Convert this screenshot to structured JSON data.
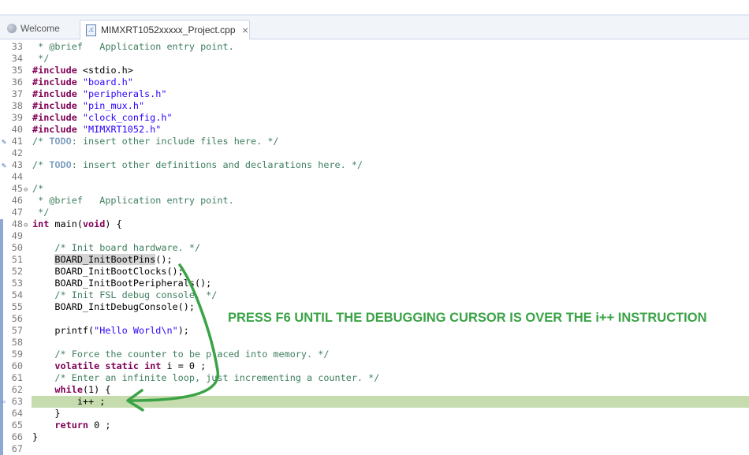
{
  "tabs": [
    {
      "label": "Welcome",
      "icon": "globe-icon",
      "active": false
    },
    {
      "label": "MIMXRT1052xxxxx_Project.cpp",
      "icon": "cpp-file-icon",
      "active": true,
      "close": "⨯"
    }
  ],
  "editor": {
    "lines": [
      {
        "n": "33",
        "t": " * @brief   Application entry point."
      },
      {
        "n": "34",
        "t": " */"
      },
      {
        "n": "35",
        "t": "#include <stdio.h>"
      },
      {
        "n": "36",
        "t": "#include \"board.h\""
      },
      {
        "n": "37",
        "t": "#include \"peripherals.h\""
      },
      {
        "n": "38",
        "t": "#include \"pin_mux.h\""
      },
      {
        "n": "39",
        "t": "#include \"clock_config.h\""
      },
      {
        "n": "40",
        "t": "#include \"MIMXRT1052.h\""
      },
      {
        "n": "41",
        "t": "/* TODO: insert other include files here. */"
      },
      {
        "n": "42",
        "t": ""
      },
      {
        "n": "43",
        "t": "/* TODO: insert other definitions and declarations here. */"
      },
      {
        "n": "44",
        "t": ""
      },
      {
        "n": "45",
        "t": "/*"
      },
      {
        "n": "46",
        "t": " * @brief   Application entry point."
      },
      {
        "n": "47",
        "t": " */"
      },
      {
        "n": "48",
        "t": "int main(void) {"
      },
      {
        "n": "49",
        "t": ""
      },
      {
        "n": "50",
        "t": "    /* Init board hardware. */"
      },
      {
        "n": "51",
        "t": "    BOARD_InitBootPins();"
      },
      {
        "n": "52",
        "t": "    BOARD_InitBootClocks();"
      },
      {
        "n": "53",
        "t": "    BOARD_InitBootPeripherals();"
      },
      {
        "n": "54",
        "t": "    /* Init FSL debug console. */"
      },
      {
        "n": "55",
        "t": "    BOARD_InitDebugConsole();"
      },
      {
        "n": "56",
        "t": ""
      },
      {
        "n": "57",
        "t": "    printf(\"Hello World\\n\");"
      },
      {
        "n": "58",
        "t": ""
      },
      {
        "n": "59",
        "t": "    /* Force the counter to be placed into memory. */"
      },
      {
        "n": "60",
        "t": "    volatile static int i = 0 ;"
      },
      {
        "n": "61",
        "t": "    /* Enter an infinite loop, just incrementing a counter. */"
      },
      {
        "n": "62",
        "t": "    while(1) {"
      },
      {
        "n": "63",
        "t": "        i++ ;"
      },
      {
        "n": "64",
        "t": "    }"
      },
      {
        "n": "65",
        "t": "    return 0 ;"
      },
      {
        "n": "66",
        "t": "}"
      },
      {
        "n": "67",
        "t": ""
      }
    ],
    "current_line": "63",
    "fold_lines": [
      "45",
      "48"
    ],
    "task_markers": [
      "41",
      "43"
    ]
  },
  "annotation": {
    "text": "PRESS F6 UNTIL THE DEBUGGING CURSOR IS OVER THE i++ INSTRUCTION",
    "color": "#3aa346"
  },
  "colors": {
    "keyword": "#7f0055",
    "string": "#2a00ff",
    "comment": "#3f7f5f",
    "todo": "#7f9fbf",
    "current_line_bg": "#c6dbae"
  }
}
